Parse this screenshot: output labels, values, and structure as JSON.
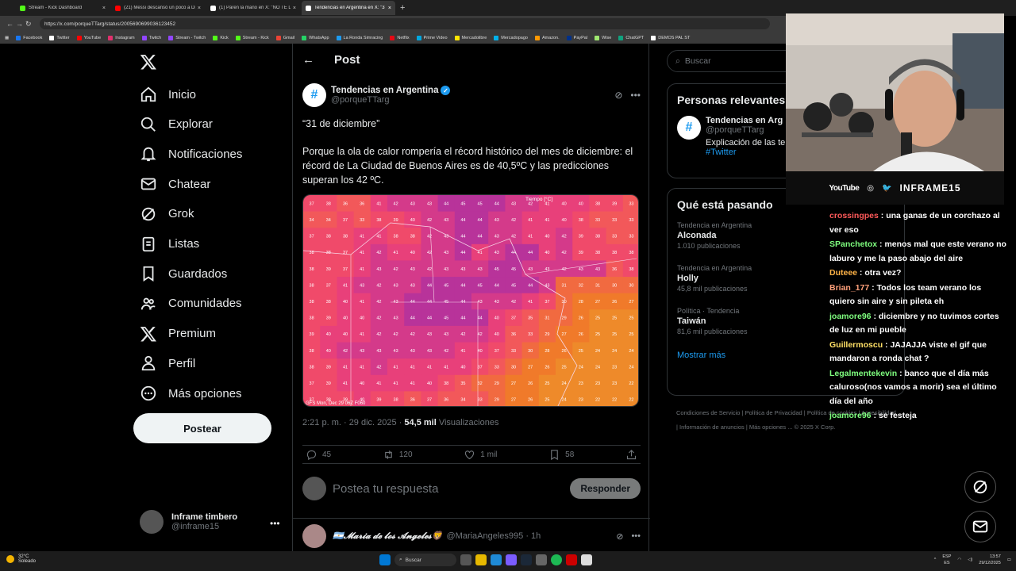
{
  "browser": {
    "tabs": [
      {
        "label": "Stream - Kick Dashboard",
        "color": "#53fc18"
      },
      {
        "label": "(21) Messi descansó un poco a Dr",
        "color": "#ff0000"
      },
      {
        "label": "(1) Paren la mano en X: \"NO TE LA",
        "color": "#ffffff"
      },
      {
        "label": "Tendencias en Argentina en X: \"3",
        "color": "#ffffff"
      }
    ],
    "url": "https://x.com/porqueTTarg/status/2005690699036123452",
    "bookmarks": [
      {
        "label": "Facebook",
        "color": "#1877f2"
      },
      {
        "label": "Twitter",
        "color": "#ffffff"
      },
      {
        "label": "YouTube",
        "color": "#ff0000"
      },
      {
        "label": "Instagram",
        "color": "#e1306c"
      },
      {
        "label": "Twitch",
        "color": "#9146ff"
      },
      {
        "label": "Stream - Twitch",
        "color": "#9146ff"
      },
      {
        "label": "Kick",
        "color": "#53fc18"
      },
      {
        "label": "Stream - Kick",
        "color": "#53fc18"
      },
      {
        "label": "Gmail",
        "color": "#ea4335"
      },
      {
        "label": "WhatsApp",
        "color": "#25d366"
      },
      {
        "label": "La Ronda Simracing",
        "color": "#1d9bf0"
      },
      {
        "label": "Netflix",
        "color": "#e50914"
      },
      {
        "label": "Prime Video",
        "color": "#00a8e1"
      },
      {
        "label": "Mercadolibre",
        "color": "#ffe600"
      },
      {
        "label": "Mercadopago",
        "color": "#00b1ea"
      },
      {
        "label": "Amazon.",
        "color": "#ff9900"
      },
      {
        "label": "PayPal",
        "color": "#003087"
      },
      {
        "label": "Wise",
        "color": "#9fe870"
      },
      {
        "label": "ChatGPT",
        "color": "#10a37f"
      },
      {
        "label": "DEMOS PAL ST",
        "color": "#ffffff"
      }
    ]
  },
  "sidebar": {
    "items": [
      {
        "label": "Inicio",
        "icon": "home-icon"
      },
      {
        "label": "Explorar",
        "icon": "search-icon"
      },
      {
        "label": "Notificaciones",
        "icon": "bell-icon"
      },
      {
        "label": "Chatear",
        "icon": "mail-icon"
      },
      {
        "label": "Grok",
        "icon": "grok-icon"
      },
      {
        "label": "Listas",
        "icon": "list-icon"
      },
      {
        "label": "Guardados",
        "icon": "bookmark-icon"
      },
      {
        "label": "Comunidades",
        "icon": "people-icon"
      },
      {
        "label": "Premium",
        "icon": "x-icon"
      },
      {
        "label": "Perfil",
        "icon": "person-icon"
      },
      {
        "label": "Más opciones",
        "icon": "more-icon"
      }
    ],
    "post_button": "Postear",
    "account": {
      "name": "Inframe timbero",
      "handle": "@inframe15"
    }
  },
  "post": {
    "header_title": "Post",
    "author_name": "Tendencias en Argentina",
    "author_handle": "@porqueTTarg",
    "quote": "“31 de diciembre”",
    "body": "Porque la ola de calor rompería el récord histórico del mes de diciembre: el récord de La Ciudad de Buenos Aires es de 40,5ºC y las predicciones superan los 42 ºC.",
    "map_title": "Tiempo [°C]",
    "map_caption": "GFS Mon, Dec 29 06Z F060",
    "map_grid": [
      [
        37,
        38,
        36,
        36,
        41,
        42,
        43,
        43,
        44,
        45,
        45,
        44,
        43,
        42,
        41,
        40,
        40,
        38,
        39,
        33
      ],
      [
        34,
        34,
        37,
        33,
        38,
        39,
        40,
        42,
        43,
        44,
        44,
        43,
        42,
        41,
        41,
        40,
        38,
        33,
        33,
        33
      ],
      [
        37,
        38,
        38,
        41,
        41,
        38,
        38,
        42,
        43,
        44,
        44,
        43,
        42,
        41,
        40,
        42,
        39,
        38,
        33,
        33
      ],
      [
        38,
        38,
        37,
        41,
        42,
        41,
        40,
        42,
        43,
        44,
        41,
        43,
        44,
        44,
        40,
        42,
        39,
        38,
        38,
        38
      ],
      [
        38,
        39,
        37,
        41,
        43,
        42,
        43,
        42,
        43,
        43,
        43,
        45,
        45,
        43,
        43,
        42,
        43,
        43,
        36,
        38
      ],
      [
        38,
        37,
        41,
        43,
        42,
        43,
        43,
        44,
        45,
        44,
        45,
        44,
        45,
        44,
        43,
        31,
        32,
        31,
        30,
        30
      ],
      [
        38,
        38,
        40,
        41,
        42,
        43,
        44,
        44,
        45,
        44,
        43,
        43,
        42,
        41,
        37,
        30,
        28,
        27,
        26,
        27
      ],
      [
        38,
        39,
        40,
        40,
        42,
        43,
        44,
        44,
        45,
        44,
        44,
        40,
        37,
        35,
        31,
        29,
        26,
        25,
        25,
        25
      ],
      [
        39,
        40,
        40,
        41,
        42,
        42,
        42,
        43,
        43,
        42,
        42,
        40,
        36,
        33,
        29,
        27,
        26,
        25,
        25,
        25
      ],
      [
        38,
        40,
        42,
        43,
        43,
        43,
        43,
        43,
        42,
        41,
        40,
        37,
        33,
        30,
        28,
        26,
        25,
        24,
        24,
        24
      ],
      [
        38,
        39,
        41,
        41,
        42,
        41,
        41,
        41,
        41,
        40,
        37,
        33,
        30,
        27,
        26,
        25,
        24,
        24,
        23,
        24
      ],
      [
        37,
        39,
        41,
        40,
        41,
        41,
        41,
        40,
        38,
        35,
        32,
        29,
        27,
        26,
        25,
        24,
        23,
        23,
        23,
        22
      ],
      [
        37,
        38,
        39,
        40,
        39,
        38,
        36,
        37,
        36,
        34,
        33,
        29,
        27,
        26,
        25,
        24,
        23,
        22,
        22,
        22
      ]
    ],
    "timestamp": "2:21 p. m. · 29 dic. 2025 · ",
    "views_count": "54,5 mil",
    "views_label": " Visualizaciones",
    "metrics": {
      "replies": "45",
      "reposts": "120",
      "likes": "1 mil",
      "bookmarks": "58"
    },
    "reply_placeholder": "Postea tu respuesta",
    "reply_button": "Responder",
    "next_post": {
      "name": "🇦🇷𝓜𝓪𝓻𝓲𝓪 𝓭𝓮 𝓵𝓸𝓼 𝓐𝓷𝓰𝓮𝓵𝓮𝓼🦁",
      "handle": "@MariaAngeles995 · 1h"
    }
  },
  "right": {
    "search_placeholder": "Buscar",
    "relevant_title": "Personas relevantes",
    "relevant_name": "Tendencias en Arg",
    "relevant_handle": "@porqueTTarg",
    "relevant_bio": "Explicación de las te",
    "relevant_tag": "#Twitter",
    "trending_title": "Qué está pasando",
    "trends": [
      {
        "context": "Tendencia en Argentina",
        "name": "Alconada",
        "count": "1.010 publicaciones"
      },
      {
        "context": "Tendencia en Argentina",
        "name": "Holly",
        "count": "45,8 mil publicaciones"
      },
      {
        "context": "Política · Tendencia",
        "name": "Taiwán",
        "count": "81,6 mil publicaciones"
      }
    ],
    "show_more": "Mostrar más",
    "footer": "Condiciones de Servicio | Política de Privacidad | Política de cookies | Accesibilidad | Información de anuncios | Más opciones ... © 2025 X Corp."
  },
  "stream": {
    "youtube": "YouTube",
    "channel": "INFRAME15",
    "chat": [
      {
        "user": "crossingpes",
        "color": "#ff5a5a",
        "text": " : una ganas de un corchazo al ver eso"
      },
      {
        "user": "SPanchetox",
        "color": "#7fff7f",
        "text": " : menos mal que este verano no laburo y me la paso abajo del aire"
      },
      {
        "user": "Duteee",
        "color": "#ffb347",
        "text": " : otra vez?"
      },
      {
        "user": "Brian_177",
        "color": "#ffa07a",
        "text": " : Todos los team verano los quiero sin aire y sin pileta eh"
      },
      {
        "user": "joamore96",
        "color": "#7fff7f",
        "text": " : diciembre y no tuvimos cortes de luz en mi pueble"
      },
      {
        "user": "Guillermoscu",
        "color": "#ffe066",
        "text": " : JAJAJJA viste el gif que mandaron a ronda chat ?"
      },
      {
        "user": "Legalmentekevin",
        "color": "#7fff7f",
        "text": " : banco que el día más caluroso(nos vamos a morir) sea el último día del año"
      },
      {
        "user": "joamore96",
        "color": "#7fff7f",
        "text": " : se festeja"
      }
    ]
  },
  "taskbar": {
    "temp": "32°C",
    "weather": "Soleado",
    "search": "Buscar",
    "lang1": "ESP",
    "lang2": "ES",
    "time": "13:57",
    "date": "29/12/2025"
  }
}
